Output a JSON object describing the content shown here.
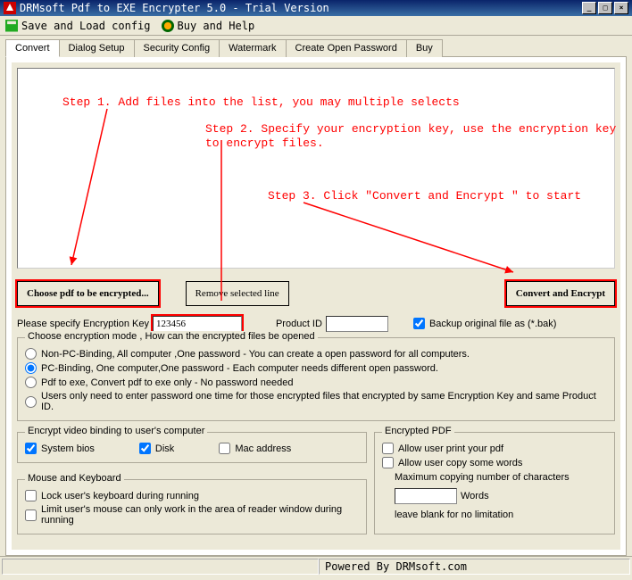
{
  "title": "DRMsoft Pdf to EXE Encrypter 5.0 - Trial Version",
  "toolbar": {
    "save": "Save and Load config",
    "help": "Buy and Help"
  },
  "tabs": [
    "Convert",
    "Dialog Setup",
    "Security Config",
    "Watermark",
    "Create Open Password",
    "Buy"
  ],
  "steps": {
    "s1": "Step 1. Add files into the list, you may multiple selects",
    "s2a": "Step 2. Specify your encryption key, use the encryption key",
    "s2b": "to encrypt files.",
    "s3": "Step 3. Click \"Convert and Encrypt \" to start"
  },
  "buttons": {
    "choose": "Choose pdf to be encrypted...",
    "remove": "Remove selected line",
    "convert": "Convert and Encrypt"
  },
  "keyrow": {
    "label": "Please specify Encryption Key",
    "value": "123456",
    "pidlabel": "Product ID",
    "pidvalue": "",
    "backup": "Backup original file as (*.bak)"
  },
  "mode": {
    "legend": "Choose encryption mode , How can the encrypted files be opened",
    "o1": "Non-PC-Binding, All computer ,One password  - You can create a open password for all computers.",
    "o2": "PC-Binding, One computer,One password  - Each computer needs different open password.",
    "o3": "Pdf to exe, Convert pdf to exe only - No password needed",
    "o4": "Users only need to enter password one time for those encrypted files that encrypted by same Encryption Key and same Product ID."
  },
  "bind": {
    "legend": "Encrypt video binding to user's computer",
    "bios": "System bios",
    "disk": "Disk",
    "mac": "Mac address"
  },
  "mk": {
    "legend": "Mouse and Keyboard",
    "lock": "Lock user's keyboard during running",
    "limit": "Limit user's mouse can only work in the area of reader window during running"
  },
  "epdf": {
    "legend": "Encrypted PDF",
    "print": "Allow user print your pdf",
    "copy": "Allow user copy some words",
    "maxlabel": "Maximum copying number of characters",
    "maxval": "",
    "words": "Words",
    "leave": "leave blank for no limitation"
  },
  "status": "Powered By DRMsoft.com"
}
